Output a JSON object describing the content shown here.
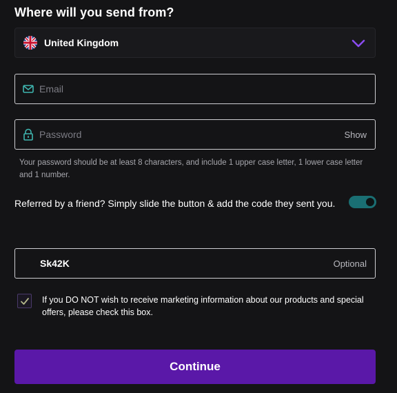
{
  "form": {
    "title": "Where will you send from?",
    "country": {
      "selected": "United Kingdom",
      "flag_icon": "uk-flag-icon",
      "dropdown_icon": "chevron-down-icon"
    },
    "email": {
      "placeholder": "Email",
      "value": "",
      "icon": "envelope-icon"
    },
    "password": {
      "placeholder": "Password",
      "value": "",
      "icon": "lock-icon",
      "show_label": "Show"
    },
    "password_hint": "Your password should be at least 8 characters, and include 1 upper case letter, 1 lower case letter and 1 number.",
    "referral": {
      "text": "Referred by a friend? Simply slide the button & add the code they sent you.",
      "toggle_on": true
    },
    "referral_code": {
      "value": "Sk42K",
      "optional_label": "Optional"
    },
    "marketing_optout": {
      "checked": true,
      "text": "If you DO NOT wish to receive marketing information about our products and special offers, please check this box."
    },
    "continue_label": "Continue"
  },
  "colors": {
    "background": "#141416",
    "accent_purple": "#5a18a8",
    "chevron_purple": "#8b4cf0",
    "toggle_teal": "#1a6f73",
    "icon_teal": "#3fb6b0",
    "checkmark_olive": "#b5b88a"
  }
}
